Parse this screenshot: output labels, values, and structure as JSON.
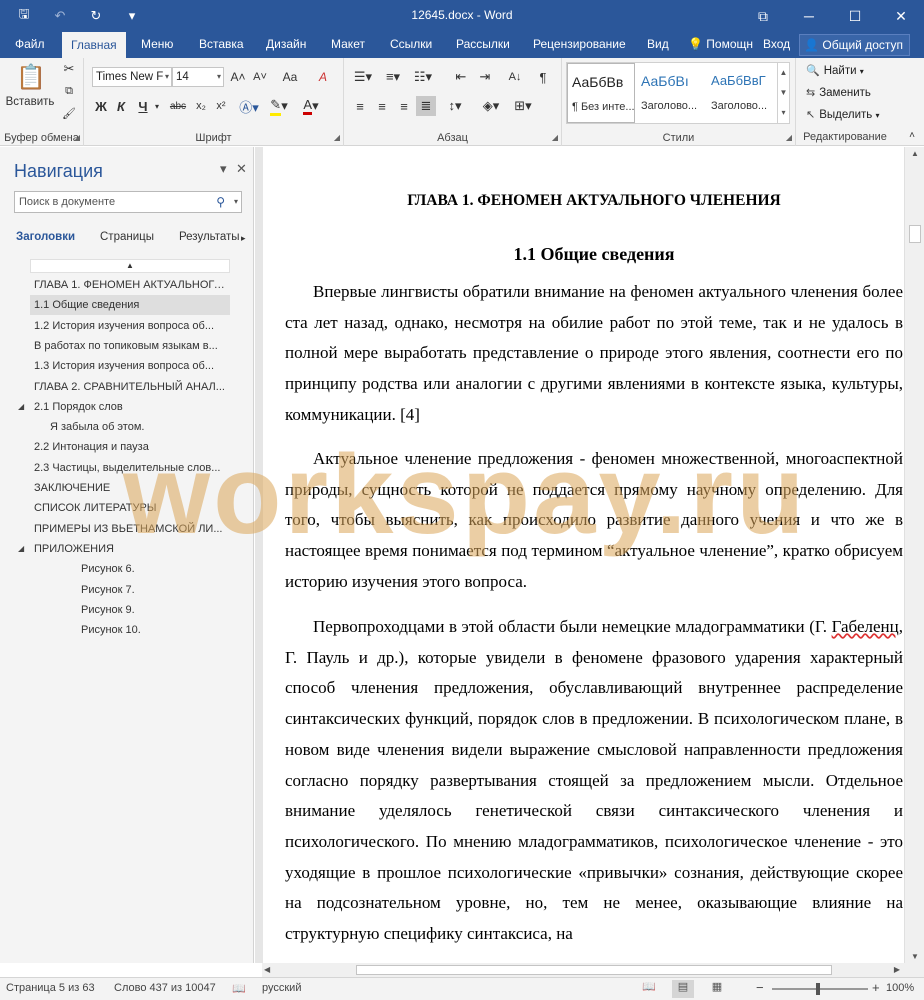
{
  "window": {
    "title": "12645.docx - Word",
    "qat": {
      "save": "🖫",
      "undo": "↶",
      "redo": "↻",
      "customize": "▾"
    },
    "controls": {
      "ribbon_opts": "⧉",
      "minimize": "─",
      "maximize": "☐",
      "close": "✕"
    }
  },
  "tabs": [
    "Файл",
    "Главная",
    "Меню",
    "Вставка",
    "Дизайн",
    "Макет",
    "Ссылки",
    "Рассылки",
    "Рецензирование",
    "Вид"
  ],
  "tab_right": {
    "help": "Помощн",
    "login": "Вход",
    "share": "Общий доступ"
  },
  "ribbon": {
    "clipboard": {
      "paste": "Вставить",
      "label": "Буфер обмена"
    },
    "font": {
      "name": "Times New F",
      "size": "14",
      "label": "Шрифт",
      "bold": "Ж",
      "italic": "К",
      "underline": "Ч",
      "strike": "abc",
      "sub": "x₂",
      "sup": "x²",
      "grow": "A˄",
      "shrink": "A˅",
      "case": "Aa",
      "clear": "A"
    },
    "paragraph": {
      "label": "Абзац"
    },
    "styles": {
      "label": "Стили",
      "items": [
        {
          "preview": "АаБбВв",
          "name": "¶ Без инте..."
        },
        {
          "preview": "АаБбВı",
          "name": "Заголово..."
        },
        {
          "preview": "АаБбВвГ",
          "name": "Заголово..."
        }
      ]
    },
    "editing": {
      "label": "Редактирование",
      "find": "Найти",
      "replace": "Заменить",
      "select": "Выделить"
    }
  },
  "nav": {
    "title": "Навигация",
    "search_placeholder": "Поиск в документе",
    "tabs": [
      "Заголовки",
      "Страницы",
      "Результаты"
    ],
    "headings": [
      {
        "text": "ГЛАВА 1. ФЕНОМЕН АКТУАЛЬНОГО...",
        "level": 1,
        "sel": false,
        "tri": false
      },
      {
        "text": "1.1 Общие сведения",
        "level": 1,
        "sel": true,
        "tri": false
      },
      {
        "text": "1.2 История изучения вопроса об...",
        "level": 1,
        "sel": false,
        "tri": false
      },
      {
        "text": "В работах по топиковым языкам в...",
        "level": 1,
        "sel": false,
        "tri": false
      },
      {
        "text": "1.3 История изучения вопроса об...",
        "level": 1,
        "sel": false,
        "tri": false
      },
      {
        "text": "ГЛАВА 2. СРАВНИТЕЛЬНЫЙ АНАЛ...",
        "level": 1,
        "sel": false,
        "tri": false
      },
      {
        "text": "2.1 Порядок слов",
        "level": 1,
        "sel": false,
        "tri": true
      },
      {
        "text": "Я забыла об этом.",
        "level": 2,
        "sel": false,
        "tri": false
      },
      {
        "text": "2.2 Интонация и пауза",
        "level": 1,
        "sel": false,
        "tri": false
      },
      {
        "text": "2.3 Частицы, выделительные слов...",
        "level": 1,
        "sel": false,
        "tri": false
      },
      {
        "text": "ЗАКЛЮЧЕНИЕ",
        "level": 1,
        "sel": false,
        "tri": false
      },
      {
        "text": "СПИСОК ЛИТЕРАТУРЫ",
        "level": 1,
        "sel": false,
        "tri": false
      },
      {
        "text": "ПРИМЕРЫ ИЗ ВЬЕТНАМСКОЙ ЛИ...",
        "level": 1,
        "sel": false,
        "tri": false
      },
      {
        "text": "ПРИЛОЖЕНИЯ",
        "level": 1,
        "sel": false,
        "tri": true
      },
      {
        "text": "Рисунок 6.",
        "level": 3,
        "sel": false,
        "tri": false
      },
      {
        "text": "Рисунок 7.",
        "level": 3,
        "sel": false,
        "tri": false
      },
      {
        "text": "Рисунок 9.",
        "level": 3,
        "sel": false,
        "tri": false
      },
      {
        "text": "Рисунок 10.",
        "level": 3,
        "sel": false,
        "tri": false
      }
    ]
  },
  "document": {
    "heading1": "ГЛАВА 1. ФЕНОМЕН АКТУАЛЬНОГО ЧЛЕНЕНИЯ",
    "heading2": "1.1 Общие сведения",
    "p1": "Впервые лингвисты обратили внимание на феномен актуального членения более ста лет назад, однако, несмотря на обилие работ по этой теме, так и не удалось в полной мере выработать представление о природе этого явления, соотнести его по принципу родства или аналогии с другими явлениями в контексте языка, культуры, коммуникации. [4]",
    "p2": "Актуальное членение предложения - феномен множественной, многоаспектной природы, сущность которой не поддается прямому научному определению. Для того, чтобы выяснить, как происходило развитие данного учения и что же в настоящее время понимается под термином “актуальное членение”, кратко обрисуем историю изучения этого вопроса.",
    "p3_start": "Первопроходцами в этой области были немецкие младограмматики (Г. ",
    "p3_underlined": "Габеленц",
    "p3_rest": ", Г. Пауль и др.), которые увидели в феномене фразового ударения характерный способ членения предложения, обуславливающий внутреннее распределение синтаксических функций, порядок слов в предложении. В психологическом плане, в новом виде членения видели выражение смысловой направленности предложения согласно порядку развертывания стоящей за предложением мысли. Отдельное внимание уделялось генетической связи синтаксического членения и психологического. По мнению младограмматиков, психологическое членение - это уходящие в прошлое психологические «привычки» сознания, действующие скорее на подсознательном уровне, но, тем не менее, оказывающие влияние на структурную специфику синтаксиса, на"
  },
  "watermark": "workspay.ru",
  "status": {
    "page": "Страница 5 из 63",
    "words": "Слово 437 из 10047",
    "lang": "русский",
    "zoom": "100%",
    "zoom_minus": "−",
    "zoom_plus": "+"
  }
}
